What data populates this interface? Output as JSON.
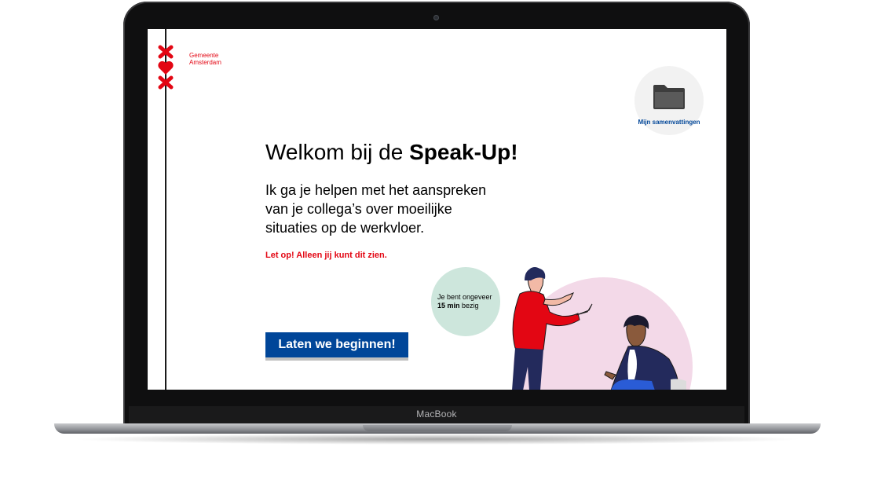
{
  "device": {
    "brand": "MacBook"
  },
  "app": {
    "organization": {
      "line1": "Gemeente",
      "line2": "Amsterdam"
    },
    "summaries": {
      "label": "Mijn samenvattingen",
      "icon": "folder-icon"
    },
    "welcome": {
      "title_prefix": "Welkom bij de ",
      "title_emphasis": "Speak-Up!"
    },
    "intro": [
      "Ik ga je helpen met het aanspreken",
      "van je collega’s over moeilijke",
      "situaties op de werkvloer."
    ],
    "warning": "Let op! Alleen jij kunt dit zien.",
    "time_badge": {
      "line1": "Je bent ongeveer",
      "duration": "15 min",
      "suffix": " bezig"
    },
    "start_button": "Laten we beginnen!"
  },
  "colors": {
    "brand_red": "#e30613",
    "brand_blue": "#004699",
    "badge_green": "#cde6dc",
    "illustration_pink": "#f3d9e8"
  }
}
